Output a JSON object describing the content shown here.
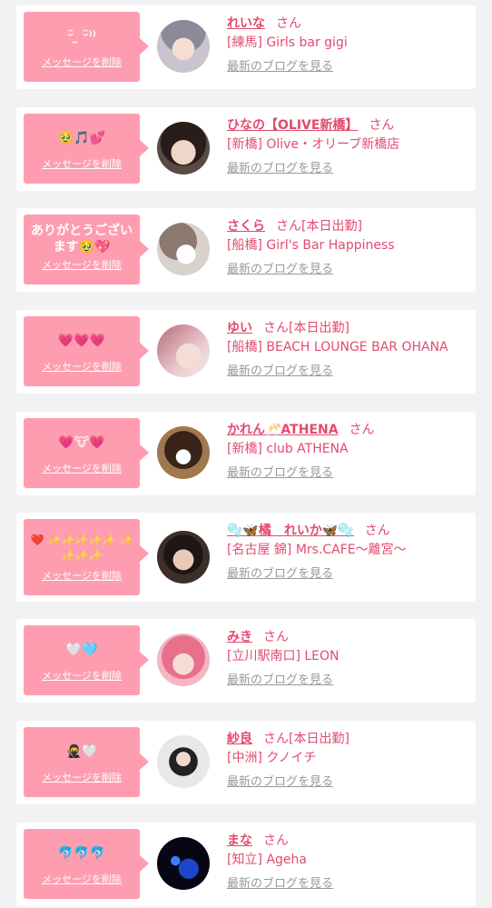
{
  "delete_label": "メッセージを削除",
  "blog_label": "最新のブログを見る",
  "san": "さん",
  "colors": {
    "bubble": "#ff9db0",
    "accent": "#e24b6f",
    "muted": "#999999",
    "background": "#f2f2f2"
  },
  "items": [
    {
      "message": "ᵕ̈ ̫ ᵕ̈⁾⁾",
      "name": "れいな",
      "status": "",
      "shop": "[練馬] Girls bar gigi"
    },
    {
      "message": "🥹🎵💕",
      "name": "ひなの【OLIVE新橋】",
      "status": "",
      "shop": "[新橋] Olive・オリーブ新橋店"
    },
    {
      "message": "ありがとうございます🥹💖",
      "name": "さくら",
      "status": "[本日出勤]",
      "shop": "[船橋] Girl's Bar Happiness"
    },
    {
      "message": "💗💗💗",
      "name": "ゆい",
      "status": "[本日出勤]",
      "shop": "[船橋] BEACH LOUNGE BAR OHANA"
    },
    {
      "message": "💗🐮💗",
      "name": "かれん🥂ATHENA",
      "status": "",
      "shop": "[新橋] club ATHENA"
    },
    {
      "message": "❤️ ✨✨✨✨✨ ✨✨✨✨",
      "name": "🫧🦋橘　れいか🦋🫧",
      "status": "",
      "shop": "[名古屋 錦] Mrs.CAFE〜離宮〜"
    },
    {
      "message": "🤍🩵",
      "name": "みき",
      "status": "",
      "shop": "[立川駅南口] LEON"
    },
    {
      "message": "🥷🤍",
      "name": "紗良",
      "status": "[本日出勤]",
      "shop": "[中洲] クノイチ"
    },
    {
      "message": "🐬🐬🐬",
      "name": "まな",
      "status": "",
      "shop": "[知立] Ageha"
    }
  ]
}
